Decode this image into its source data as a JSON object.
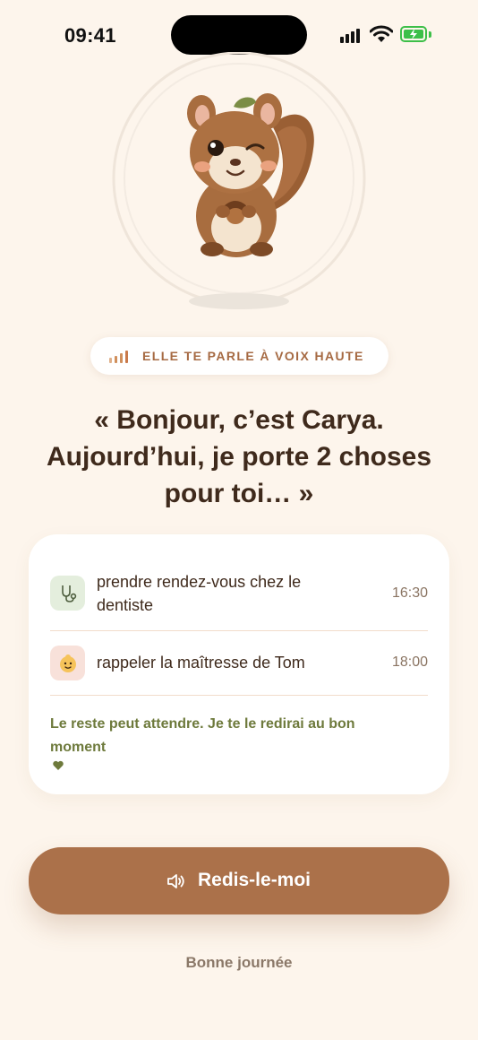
{
  "status_bar": {
    "time": "09:41"
  },
  "mascot": {
    "name_icon": "squirrel-mascot"
  },
  "voice_badge": {
    "label": "ELLE TE PARLE À VOIX HAUTE",
    "icon": "audio-level-icon"
  },
  "greeting": {
    "line1": "« Bonjour, c’est Carya.",
    "line2": "Aujourd’hui, je porte 2 choses",
    "line3": "pour toi… »"
  },
  "tasks": [
    {
      "icon": "stethoscope-icon",
      "title_line1": "prendre rendez-vous chez le",
      "title_line2": "dentiste",
      "time": "16:30"
    },
    {
      "icon": "baby-face-icon",
      "title_line1": "rappeler la maîtresse de Tom",
      "time": "18:00"
    }
  ],
  "card_footer": {
    "line1": "Le reste peut attendre. Je te le redirai au bon",
    "line2": "moment"
  },
  "replay_button": {
    "label": "Redis-le-moi"
  },
  "goodbye": "Bonne journée",
  "colors": {
    "background": "#fdf5ec",
    "accent": "#ab714a",
    "green_text": "#6e7a3c"
  }
}
